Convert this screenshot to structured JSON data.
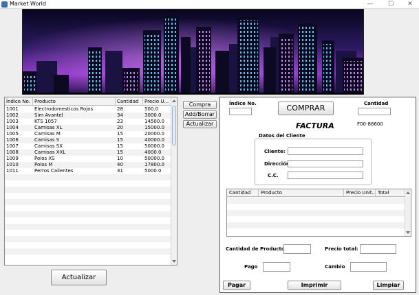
{
  "window": {
    "title": "Market World",
    "controls": {
      "minimize": "—",
      "maximize": "☐",
      "close": "✕"
    }
  },
  "products_table": {
    "headers": [
      "Índice No.",
      "Producto",
      "Cantidad",
      "Precio U..."
    ],
    "rows": [
      [
        "1001",
        "Electrodomesticos Rojos",
        "28",
        "500.0"
      ],
      [
        "1002",
        "Sim Avantel",
        "34",
        "3000.0"
      ],
      [
        "1003",
        "KTS 1057",
        "23",
        "14500.0"
      ],
      [
        "1004",
        "Camisas XL",
        "20",
        "15000.0"
      ],
      [
        "1005",
        "Camisas M",
        "15",
        "20000.0"
      ],
      [
        "1006",
        "Camisas S",
        "15",
        "40000.0"
      ],
      [
        "1007",
        "Camisas SX",
        "15",
        "50000.0"
      ],
      [
        "1008",
        "Camisas XXL",
        "15",
        "4000.0"
      ],
      [
        "1009",
        "Polos XS",
        "10",
        "50000.0"
      ],
      [
        "1010",
        "Polos M",
        "40",
        "17800.0"
      ],
      [
        "1011",
        "Perros Calientes",
        "31",
        "5000.0"
      ]
    ]
  },
  "left_buttons": {
    "actualizar": "Actualizar"
  },
  "side_buttons": {
    "compra": "Compra",
    "add_borrar": "Add/Borrar",
    "actualizar": "Actualizar"
  },
  "invoice": {
    "indice_label": "Índice No.",
    "indice_value": "",
    "comprar_label": "COMPRAR",
    "cantidad_label": "Cantidad",
    "cantidad_value": "",
    "factura_title": "FACTURA",
    "invoice_number": "F00-88600",
    "datos_cliente_title": "Datos del Cliente",
    "cliente_label": "Cliente:",
    "cliente_value": "",
    "direccion_label": "Dirección:",
    "direccion_value": "",
    "cc_label": "C.C.",
    "cc_value": "",
    "items_table_headers": [
      "Cantidad",
      "Producto",
      "Precio Unit...",
      "Total"
    ],
    "cantidad_productos_label": "Cantidad de Productos:",
    "cantidad_productos_value": "",
    "precio_total_label": "Precio total:",
    "precio_total_value": "",
    "pago_label": "Pago",
    "pago_value": "",
    "cambio_label": "Cambio",
    "cambio_value": "",
    "pagar_button": "Pagar",
    "imprimir_button": "Imprimir",
    "limpiar_button": "Limpiar"
  },
  "colors": {
    "banner_sky_top": "#0a0824",
    "banner_sky_glow": "#b03ad6",
    "banner_building_light": "#4fd6ff",
    "row_alt": "#f2f2f2"
  }
}
